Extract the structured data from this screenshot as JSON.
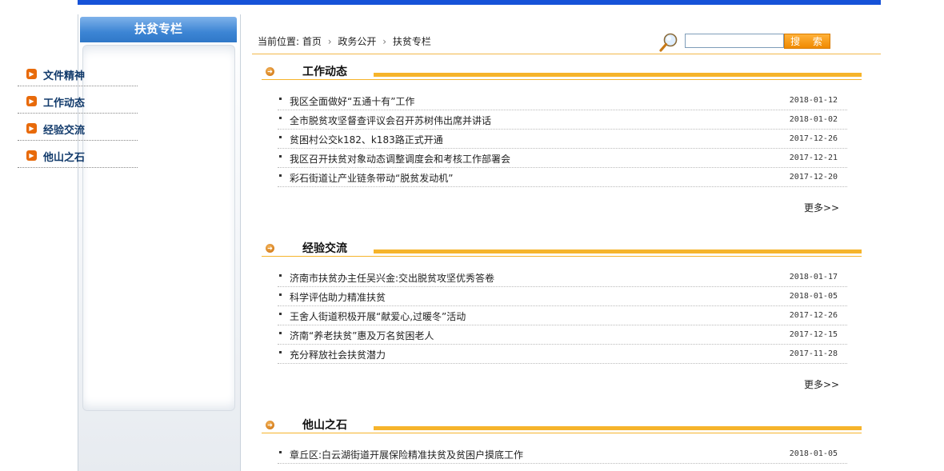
{
  "sidebar": {
    "title": "扶贫专栏",
    "items": [
      {
        "label": "文件精神"
      },
      {
        "label": "工作动态"
      },
      {
        "label": "经验交流"
      },
      {
        "label": "他山之石"
      }
    ]
  },
  "breadcrumb": {
    "prefix": "当前位置:",
    "items": [
      "首页",
      "政务公开",
      "扶贫专栏"
    ]
  },
  "search": {
    "value": "",
    "button_label": "搜 索"
  },
  "more_label": "更多>>",
  "sections": [
    {
      "title": "工作动态",
      "items": [
        {
          "title": "我区全面做好“五通十有”工作",
          "date": "2018-01-12"
        },
        {
          "title": "全市脱贫攻坚督查评议会召开苏树伟出席并讲话",
          "date": "2018-01-02"
        },
        {
          "title": "贫困村公交k182、k183路正式开通",
          "date": "2017-12-26"
        },
        {
          "title": "我区召开扶贫对象动态调整调度会和考核工作部署会",
          "date": "2017-12-21"
        },
        {
          "title": "彩石街道让产业链条带动“脱贫发动机”",
          "date": "2017-12-20"
        }
      ]
    },
    {
      "title": "经验交流",
      "items": [
        {
          "title": "济南市扶贫办主任吴兴金:交出脱贫攻坚优秀答卷",
          "date": "2018-01-17"
        },
        {
          "title": "科学评估助力精准扶贫",
          "date": "2018-01-05"
        },
        {
          "title": "王舍人街道积极开展“献爱心,过暖冬”活动",
          "date": "2017-12-26"
        },
        {
          "title": "济南“养老扶贫”惠及万名贫困老人",
          "date": "2017-12-15"
        },
        {
          "title": "充分释放社会扶贫潜力",
          "date": "2017-11-28"
        }
      ]
    },
    {
      "title": "他山之石",
      "items": [
        {
          "title": "章丘区:白云湖街道开展保险精准扶贫及贫困户摸底工作",
          "date": "2018-01-05"
        }
      ]
    }
  ]
}
